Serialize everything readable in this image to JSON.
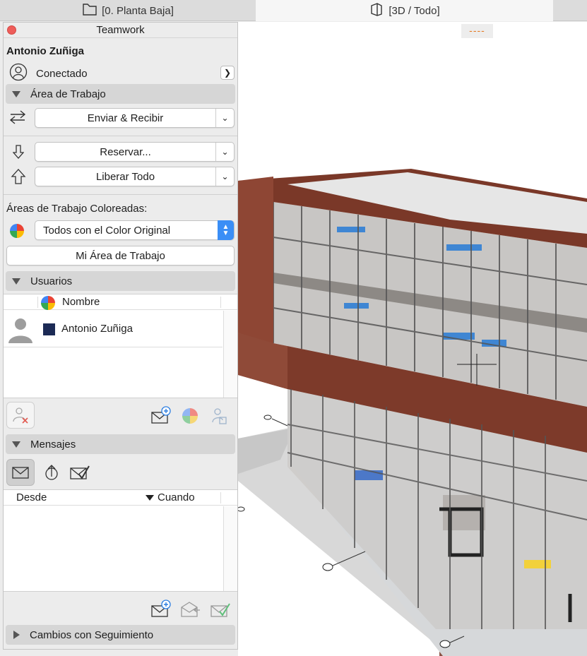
{
  "tabs": [
    {
      "label": "[0. Planta Baja]",
      "icon": "floor-plan-icon"
    },
    {
      "label": "[3D / Todo]",
      "icon": "3d-view-icon"
    }
  ],
  "panel": {
    "title": "Teamwork",
    "user_name": "Antonio Zuñiga",
    "status": "Conectado",
    "workspace_section": "Área de Trabajo",
    "send_receive": "Enviar & Recibir",
    "reserve": "Reservar...",
    "release_all": "Liberar Todo",
    "colored_areas_label": "Áreas de Trabajo Coloreadas:",
    "color_select": "Todos con el Color Original",
    "my_workspace": "Mi Área de Trabajo",
    "users_section": "Usuarios",
    "users_col_name": "Nombre",
    "users": [
      {
        "name": "Antonio Zuñiga",
        "color": "#1c2a55"
      }
    ],
    "messages_section": "Mensajes",
    "messages_col_from": "Desde",
    "messages_col_when": "Cuando",
    "tracked_changes_section": "Cambios con Seguimiento"
  },
  "viewport": {
    "dash_tag": "----"
  },
  "colors": {
    "accent": "#3a8ef6",
    "close": "#ee5d5a",
    "dash": "#e57a23"
  }
}
